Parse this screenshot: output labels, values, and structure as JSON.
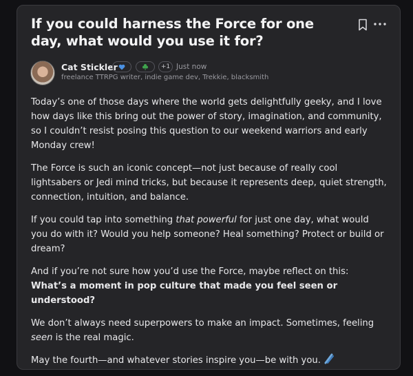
{
  "post": {
    "title": "If you could harness the Force for one day, what would you use it for?",
    "author": {
      "name": "Cat Stickler",
      "bio": "freelance TTRPG writer, indie game dev, Trekkie, blacksmith",
      "extra_badges": "+1",
      "timestamp": "Just now"
    },
    "p1": "Today’s one of those days where the world gets delightfully geeky, and I love how days like this bring out the power of story, imagination, and community, so I couldn’t resist posing this question to our weekend warriors and early Monday crew!",
    "p2": "The Force is such an iconic concept—not just because of really cool lightsabers or Jedi mind tricks, but because it represents deep, quiet strength, connection, intuition, and balance.",
    "p3_a": "If you could tap into something ",
    "p3_em": "that powerful",
    "p3_b": " for just one day, what would you do with it? Would you help someone? Heal something? Protect or build or dream?",
    "p4_a": "And if you’re not sure how you’d use the Force, maybe reflect on this:",
    "p4_strong": "What’s a moment in pop culture that made you feel seen or understood?",
    "p5_a": "We don’t always need superpowers to make an impact. Sometimes, feeling ",
    "p5_em": "seen",
    "p5_b": " is the real magic.",
    "p6": "May the fourth—and whatever stories inspire you—be with you."
  },
  "icons": {
    "bookmark": "bookmark-icon",
    "more": "more-options-icon",
    "heart_badge": "blue-heart-icon",
    "clover_badge": "clover-icon",
    "end_emoji": "lightsaber-icon"
  },
  "colors": {
    "background": "#111114",
    "card": "#252528",
    "text": "#e8e8ea",
    "muted": "#9a9aa0",
    "heart": "#4a90e2",
    "clover": "#3fa34d"
  }
}
